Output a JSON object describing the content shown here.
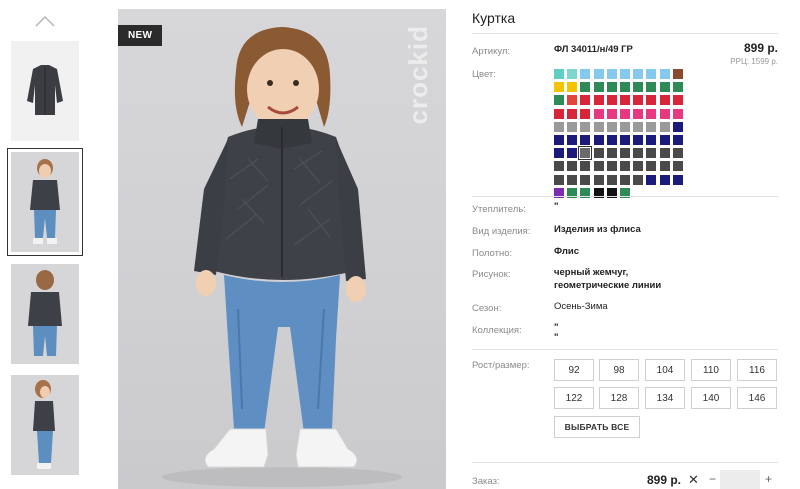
{
  "gallery": {
    "badge": "NEW",
    "watermark": "crockid",
    "up_icon": "chevron-up-icon",
    "thumbnails": [
      {
        "alt": "jacket-flat"
      },
      {
        "alt": "child-front"
      },
      {
        "alt": "child-back"
      },
      {
        "alt": "child-side"
      }
    ],
    "active_thumbnail": 1
  },
  "product": {
    "title": "Куртка",
    "price": "899 р.",
    "rrp": "РРЦ: 1599 р.",
    "labels": {
      "article": "Артикул:",
      "color": "Цвет:",
      "insulation": "Утеплитель:",
      "type": "Вид изделия:",
      "fabric": "Полотно:",
      "pattern": "Рисунок:",
      "season": "Сезон:",
      "collection": "Коллекция:",
      "size": "Рост/размер:"
    },
    "values": {
      "article": "ФЛ 34011/н/49 ГР",
      "insulation": "\"",
      "type": "Изделия из флиса",
      "fabric": "Флис",
      "pattern_line1": "черный жемчуг,",
      "pattern_line2": "геометрические линии",
      "season": "Осень-Зима",
      "collection_line1": "\"",
      "collection_line2": "\""
    },
    "swatch_rows": [
      [
        "#5fcfc3",
        "#7fd6cf",
        "#86c9ee",
        "#86c9ee",
        "#86c9ee",
        "#86c9ee",
        "#86c9ee",
        "#86c9ee",
        "#86c9ee",
        "#8b4a2f"
      ],
      [
        "#f4c400",
        "#f4c400",
        "#2e8b57",
        "#2e8b57",
        "#2e8b57",
        "#2e8b57",
        "#2e8b57",
        "#2e8b57",
        "#2e8b57",
        "#2e8b57"
      ],
      [
        "#2e8b57",
        "#e0443c",
        "#d9253a",
        "#d9253a",
        "#d9253a",
        "#d9253a",
        "#d9253a",
        "#d9253a",
        "#d9253a",
        "#d9253a"
      ],
      [
        "#d9253a",
        "#d9253a",
        "#d9253a",
        "#e63982",
        "#e63982",
        "#e63982",
        "#e63982",
        "#e63982",
        "#e63982",
        "#e63982"
      ],
      [
        "#9a9a9a",
        "#9a9a9a",
        "#9a9a9a",
        "#9a9a9a",
        "#9a9a9a",
        "#9a9a9a",
        "#9a9a9a",
        "#9a9a9a",
        "#9a9a9a",
        "#1c1a7a"
      ],
      [
        "#1c1a7a",
        "#1c1a7a",
        "#1c1a7a",
        "#1c1a7a",
        "#1c1a7a",
        "#1c1a7a",
        "#1c1a7a",
        "#1c1a7a",
        "#1c1a7a",
        "#1c1a7a"
      ],
      [
        "#1c1a7a",
        "#1c1a7a",
        "#6a6a6a",
        "#4a4a4a",
        "#4a4a4a",
        "#4a4a4a",
        "#4a4a4a",
        "#4a4a4a",
        "#4a4a4a",
        "#4a4a4a"
      ],
      [
        "#4a4a4a",
        "#4a4a4a",
        "#4a4a4a",
        "#4a4a4a",
        "#4a4a4a",
        "#4a4a4a",
        "#4a4a4a",
        "#4a4a4a",
        "#4a4a4a",
        "#4a4a4a"
      ],
      [
        "#4a4a4a",
        "#4a4a4a",
        "#4a4a4a",
        "#4a4a4a",
        "#4a4a4a",
        "#4a4a4a",
        "#4a4a4a",
        "#1c1a7a",
        "#1c1a7a",
        "#1c1a7a"
      ],
      [
        "#7b2cb3",
        "#2e8b57",
        "#2e8b57",
        "#111111",
        "#111111",
        "#2e8b57"
      ]
    ],
    "selected_swatch": [
      6,
      2
    ],
    "sizes": [
      "92",
      "98",
      "104",
      "110",
      "116",
      "122",
      "128",
      "134",
      "140",
      "146"
    ],
    "select_all_label": "ВЫБРАТЬ ВСЕ"
  },
  "order": {
    "label": "Заказ:",
    "price": "899 р.",
    "remove_symbol": "✕",
    "minus_symbol": "−",
    "plus_symbol": "+",
    "quantity": ""
  }
}
